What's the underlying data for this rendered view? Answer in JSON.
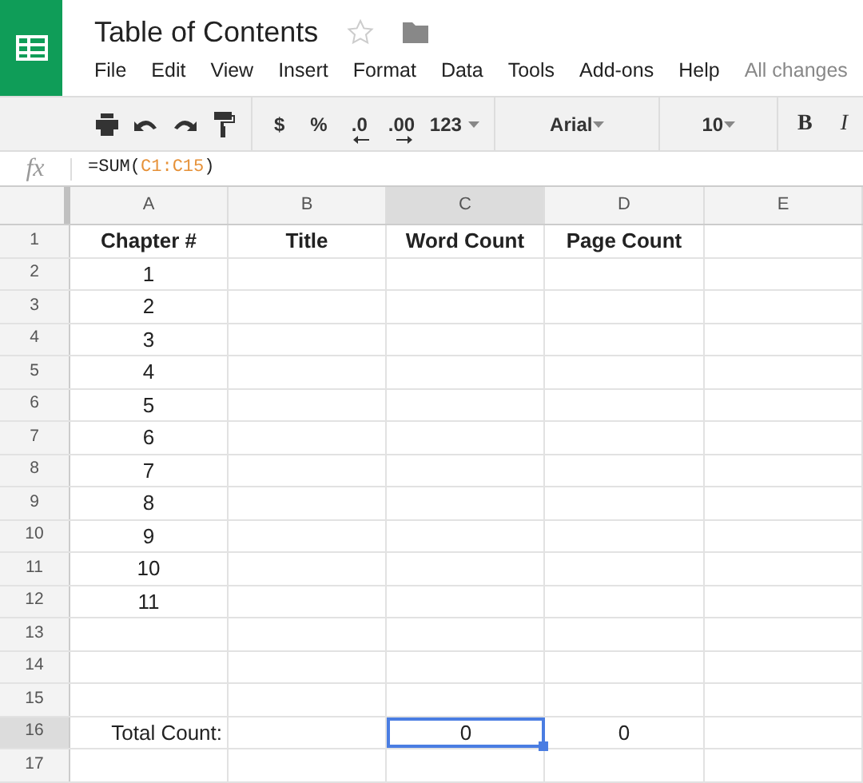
{
  "document": {
    "title": "Table of Contents",
    "starred": false
  },
  "menu": [
    "File",
    "Edit",
    "View",
    "Insert",
    "Format",
    "Data",
    "Tools",
    "Add-ons",
    "Help"
  ],
  "save_status": "All changes",
  "toolbar": [
    {
      "kind": "print"
    },
    {
      "kind": "undo"
    },
    {
      "kind": "redo"
    },
    {
      "kind": "paint"
    },
    {
      "kind": "sep"
    },
    {
      "kind": "text",
      "label": "$"
    },
    {
      "kind": "text",
      "label": "%"
    },
    {
      "kind": "dec-left",
      "label": ".0"
    },
    {
      "kind": "dec-right",
      "label": ".00"
    },
    {
      "kind": "dropdown",
      "label": "123"
    },
    {
      "kind": "sep"
    },
    {
      "kind": "font-select",
      "label": "Arial"
    },
    {
      "kind": "sep"
    },
    {
      "kind": "size-select",
      "label": "10"
    },
    {
      "kind": "sep"
    },
    {
      "kind": "bold",
      "label": "B"
    },
    {
      "kind": "italic",
      "label": "I"
    }
  ],
  "formula_bar": {
    "label": "fx",
    "parts": [
      {
        "kind": "plain",
        "text": "=SUM("
      },
      {
        "kind": "ref",
        "text": "C1:C15"
      },
      {
        "kind": "plain",
        "text": ")"
      }
    ]
  },
  "columns": [
    {
      "label": "A",
      "selected": false
    },
    {
      "label": "B",
      "selected": false
    },
    {
      "label": "C",
      "selected": true
    },
    {
      "label": "D",
      "selected": false
    },
    {
      "label": "E",
      "selected": false
    }
  ],
  "rows": [
    {
      "label": "1",
      "selected": false,
      "kind": "header",
      "cells": {
        "a": {
          "text": "Chapter #",
          "selected": false
        },
        "b": {
          "text": "Title",
          "selected": false
        },
        "c": {
          "text": "Word Count",
          "selected": false
        },
        "d": {
          "text": "Page Count",
          "selected": false
        }
      }
    },
    {
      "label": "2",
      "selected": false,
      "kind": "data",
      "cells": {
        "a": {
          "text": "1",
          "selected": false
        }
      }
    },
    {
      "label": "3",
      "selected": false,
      "kind": "data",
      "cells": {
        "a": {
          "text": "2",
          "selected": false
        }
      }
    },
    {
      "label": "4",
      "selected": false,
      "kind": "data",
      "cells": {
        "a": {
          "text": "3",
          "selected": false
        }
      }
    },
    {
      "label": "5",
      "selected": false,
      "kind": "data",
      "cells": {
        "a": {
          "text": "4",
          "selected": false
        }
      }
    },
    {
      "label": "6",
      "selected": false,
      "kind": "data",
      "cells": {
        "a": {
          "text": "5",
          "selected": false
        }
      }
    },
    {
      "label": "7",
      "selected": false,
      "kind": "data",
      "cells": {
        "a": {
          "text": "6",
          "selected": false
        }
      }
    },
    {
      "label": "8",
      "selected": false,
      "kind": "data",
      "cells": {
        "a": {
          "text": "7",
          "selected": false
        }
      }
    },
    {
      "label": "9",
      "selected": false,
      "kind": "data",
      "cells": {
        "a": {
          "text": "8",
          "selected": false
        }
      }
    },
    {
      "label": "10",
      "selected": false,
      "kind": "data",
      "cells": {
        "a": {
          "text": "9",
          "selected": false
        }
      }
    },
    {
      "label": "11",
      "selected": false,
      "kind": "data",
      "cells": {
        "a": {
          "text": "10",
          "selected": false
        }
      }
    },
    {
      "label": "12",
      "selected": false,
      "kind": "data",
      "cells": {
        "a": {
          "text": "11",
          "selected": false
        }
      }
    },
    {
      "label": "13",
      "selected": false
    },
    {
      "label": "14",
      "selected": false
    },
    {
      "label": "15",
      "selected": false
    },
    {
      "label": "16",
      "selected": true,
      "kind": "total",
      "cells": {
        "a": {
          "text": "Total Count:",
          "selected": false
        },
        "c": {
          "text": "0",
          "selected": true
        },
        "d": {
          "text": "0",
          "selected": false
        }
      }
    },
    {
      "label": "17",
      "selected": false
    }
  ]
}
